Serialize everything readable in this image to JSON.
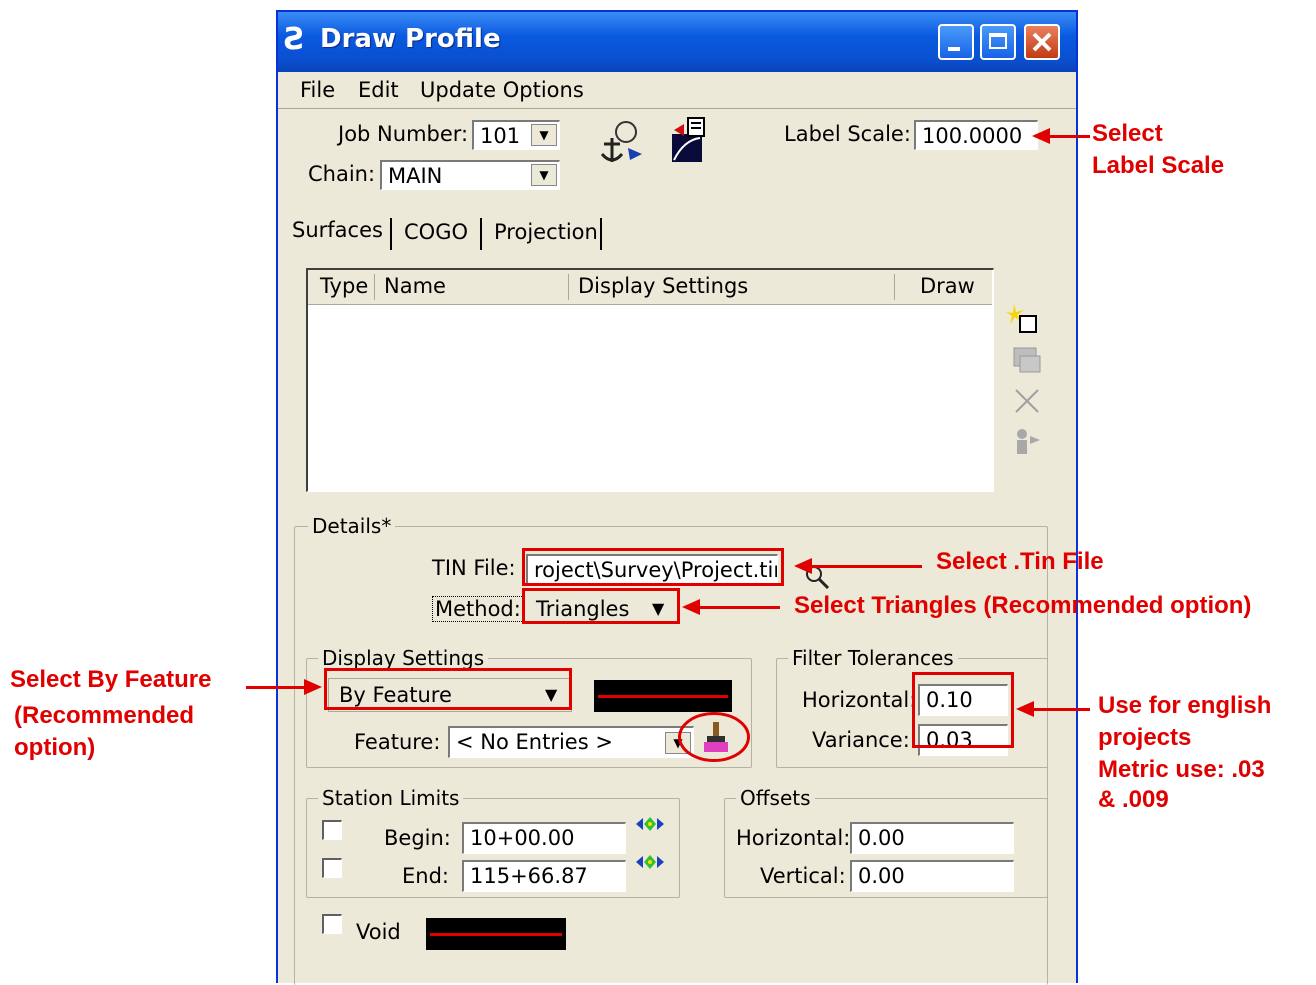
{
  "window": {
    "title": "Draw Profile",
    "app_logo": "Ƨ",
    "accent_color": "#0a5ae0",
    "close_color": "#c23a14"
  },
  "menu": {
    "file": "File",
    "edit": "Edit",
    "update_options": "Update Options"
  },
  "header": {
    "job_number_label": "Job Number:",
    "job_number_value": "101",
    "chain_label": "Chain:",
    "chain_value": "MAIN",
    "label_scale_label": "Label Scale:",
    "label_scale_value": "100.0000"
  },
  "tabs": {
    "surfaces": "Surfaces",
    "cogo": "COGO",
    "projection": "Projection"
  },
  "surface_list": {
    "columns": [
      "Type",
      "Name",
      "Display Settings",
      "Draw"
    ]
  },
  "details": {
    "group_title": "Details*",
    "tin_file_label": "TIN File:",
    "tin_file_value": "roject\\Survey\\Project.tin",
    "method_label": "Method:",
    "method_value": "Triangles"
  },
  "display_settings": {
    "group_title": "Display Settings",
    "mode_value": "By Feature",
    "feature_label": "Feature:",
    "feature_value": "< No Entries >",
    "swatch_color": "#e00000"
  },
  "filter_tolerances": {
    "group_title": "Filter Tolerances",
    "horizontal_label": "Horizontal:",
    "horizontal_value": "0.10",
    "variance_label": "Variance:",
    "variance_value": "0.03"
  },
  "station_limits": {
    "group_title": "Station Limits",
    "begin_label": "Begin:",
    "begin_value": "10+00.00",
    "end_label": "End:",
    "end_value": "115+66.87"
  },
  "offsets": {
    "group_title": "Offsets",
    "horizontal_label": "Horizontal:",
    "horizontal_value": "0.00",
    "vertical_label": "Vertical:",
    "vertical_value": "0.00"
  },
  "void": {
    "label": "Void"
  },
  "annotations": {
    "label_scale_line1": "Select",
    "label_scale_line2": "Label Scale",
    "tin_file": "Select .Tin File",
    "triangles": "Select Triangles (Recommended option)",
    "by_feature_line1": "Select By Feature",
    "by_feature_line2": "(Recommended",
    "by_feature_line3": "option)",
    "tolerances_line1": "Use for english",
    "tolerances_line2": "projects",
    "tolerances_line3": "Metric use: .03",
    "tolerances_line4": "& .009",
    "color": "#e00000"
  }
}
